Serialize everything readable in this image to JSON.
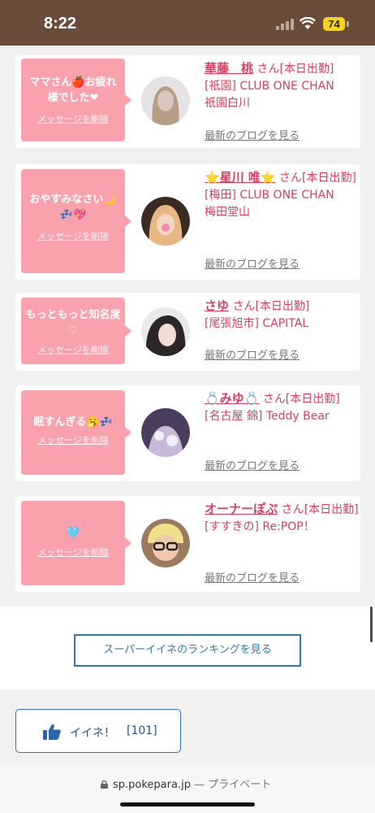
{
  "status": {
    "time": "8:22",
    "battery": "74"
  },
  "cards": [
    {
      "message": "ママさん🍎お疲れ様でした❤",
      "delete_label": "メッセージを削除",
      "name": "華藤　桃",
      "san": "さん[本日出勤]",
      "shop": "[祇園] CLUB ONE CHAN",
      "area": "祇園白川",
      "blog": "最新のブログを見る"
    },
    {
      "message": "おやすみなさい🌙💤💖",
      "delete_label": "メッセージを削除",
      "name": "⭐星川 唯⭐",
      "san": "さん[本日出勤]",
      "shop": "[梅田] CLUB ONE CHAN",
      "area": "梅田堂山",
      "blog": "最新のブログを見る"
    },
    {
      "message": "もっともっと知名度♡",
      "delete_label": "メッセージを削除",
      "name": "さゆ",
      "san": "さん[本日出勤]",
      "shop": "[尾張旭市] CAPITAL",
      "area": "",
      "blog": "最新のブログを見る"
    },
    {
      "message": "眠すんぎる🥱💤",
      "delete_label": "メッセージを削除",
      "name": "💍みゆ💍",
      "san": "さん[本日出勤]",
      "shop": "[名古屋 錦] Teddy Bear",
      "area": "",
      "blog": "最新のブログを見る"
    },
    {
      "message": "🩵",
      "delete_label": "メッセージを削除",
      "name": "オーナーぽぷ",
      "san": "さん[本日出勤]",
      "shop": "[すすきの] Re:POP！",
      "area": "",
      "blog": "最新のブログを見る"
    }
  ],
  "ranking_button": "スーパーイイネのランキングを見る",
  "like_button": {
    "label": "イイネ！",
    "count": "[101]"
  },
  "url_bar": {
    "domain": "sp.pokepara.jp",
    "separator": " — ",
    "mode": "プライベート"
  },
  "colors": {
    "bubble": "#f9a2ad",
    "name": "#d64263",
    "link": "#2f7dab",
    "status_bar": "#6b4b3a"
  }
}
